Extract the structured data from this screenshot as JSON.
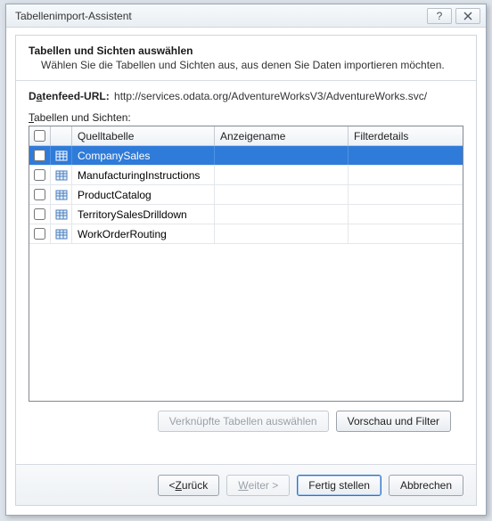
{
  "window": {
    "title": "Tabellenimport-Assistent"
  },
  "heading": "Tabellen und Sichten auswählen",
  "subheading": "Wählen Sie die Tabellen und Sichten aus, aus denen Sie Daten importieren möchten.",
  "feed": {
    "label_pre": "D",
    "label_ul": "a",
    "label_post": "tenfeed-URL:",
    "url": "http://services.odata.org/AdventureWorksV3/AdventureWorks.svc/"
  },
  "list_label": {
    "ul": "T",
    "rest": "abellen und Sichten:"
  },
  "columns": {
    "source": "Quelltabelle",
    "display": "Anzeigename",
    "filter": "Filterdetails"
  },
  "rows": [
    {
      "source": "CompanySales",
      "display": "",
      "filter": "",
      "checked": false,
      "selected": true
    },
    {
      "source": "ManufacturingInstructions",
      "display": "",
      "filter": "",
      "checked": false,
      "selected": false
    },
    {
      "source": "ProductCatalog",
      "display": "",
      "filter": "",
      "checked": false,
      "selected": false
    },
    {
      "source": "TerritorySalesDrilldown",
      "display": "",
      "filter": "",
      "checked": false,
      "selected": false
    },
    {
      "source": "WorkOrderRouting",
      "display": "",
      "filter": "",
      "checked": false,
      "selected": false
    }
  ],
  "buttons": {
    "select_related": "Verknüpfte Tabellen auswählen",
    "preview_filter": "Vorschau und Filter",
    "back_pre": "< ",
    "back_ul": "Z",
    "back_post": "urück",
    "next_ul": "W",
    "next_post": "eiter >",
    "finish": "Fertig stellen",
    "cancel": "Abbrechen"
  }
}
